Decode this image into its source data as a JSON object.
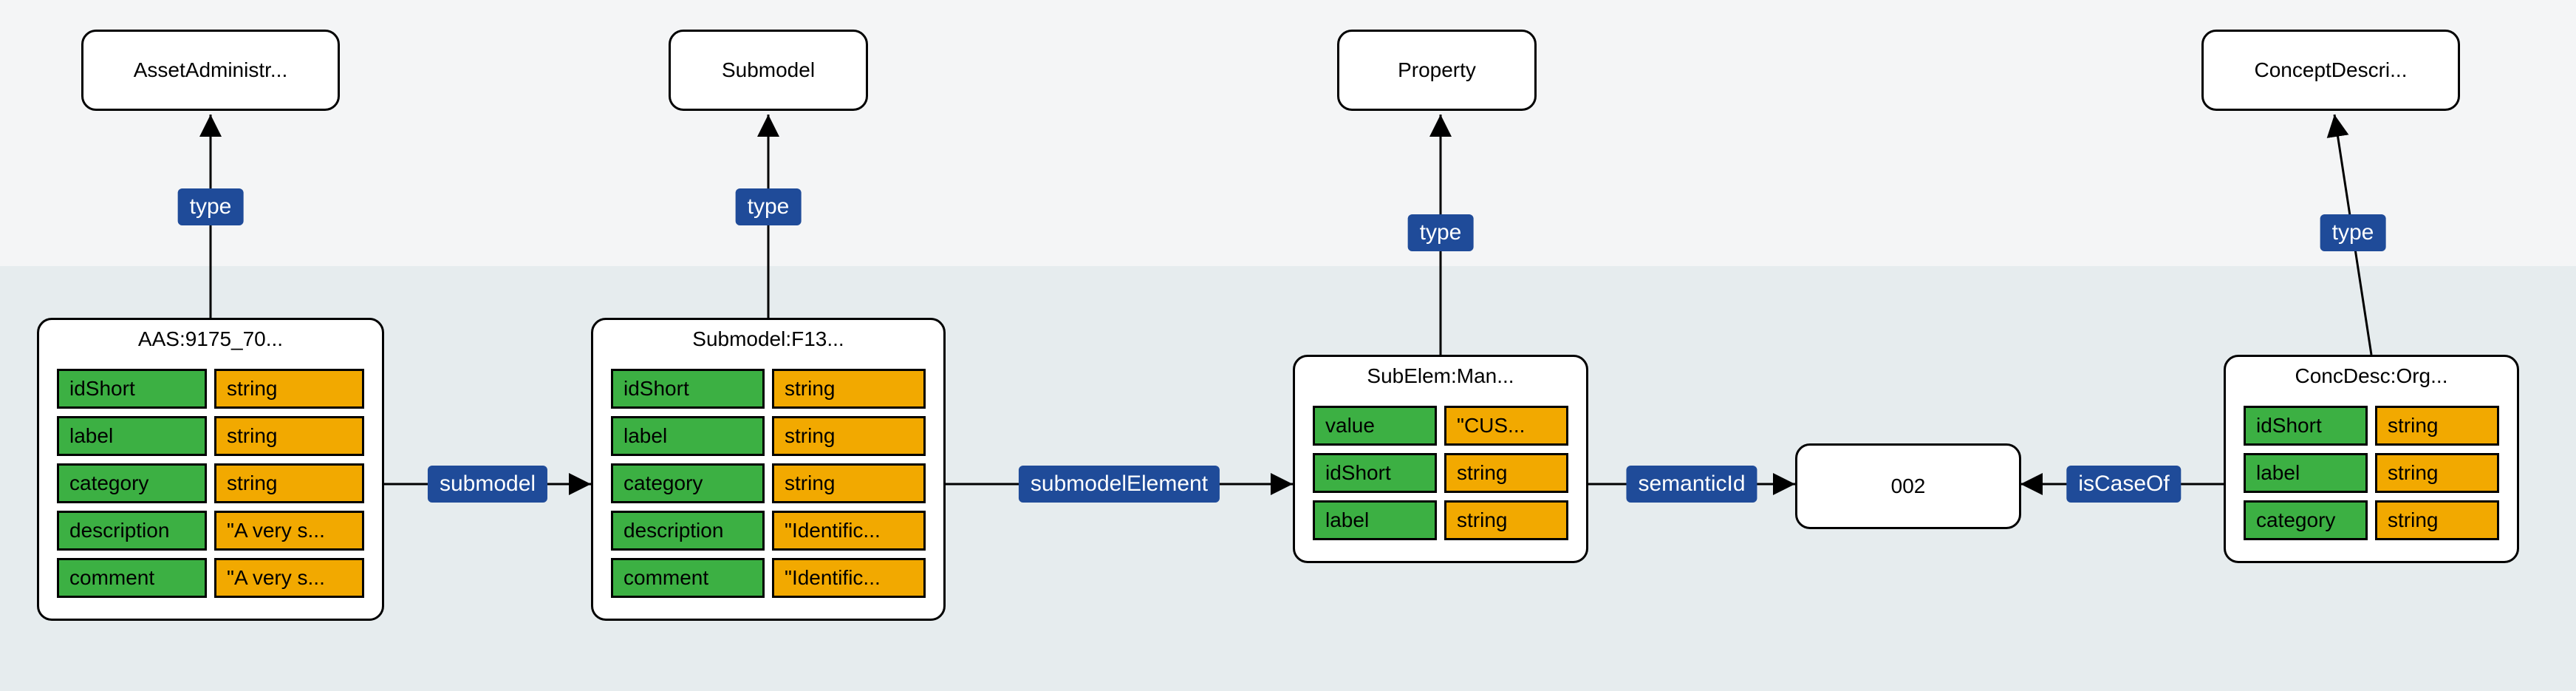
{
  "types": {
    "aas": "AssetAdministr...",
    "sub": "Submodel",
    "prop": "Property",
    "conc": "ConceptDescri..."
  },
  "records": {
    "aas": {
      "title": "AAS:9175_70...",
      "rows": [
        {
          "k": "idShort",
          "v": "string"
        },
        {
          "k": "label",
          "v": "string"
        },
        {
          "k": "category",
          "v": "string"
        },
        {
          "k": "description",
          "v": "\"A very s..."
        },
        {
          "k": "comment",
          "v": "\"A very s..."
        }
      ]
    },
    "sub": {
      "title": "Submodel:F13...",
      "rows": [
        {
          "k": "idShort",
          "v": "string"
        },
        {
          "k": "label",
          "v": "string"
        },
        {
          "k": "category",
          "v": "string"
        },
        {
          "k": "description",
          "v": "\"Identific..."
        },
        {
          "k": "comment",
          "v": "\"Identific..."
        }
      ]
    },
    "prop": {
      "title": "SubElem:Man...",
      "rows": [
        {
          "k": "value",
          "v": "\"CUS..."
        },
        {
          "k": "idShort",
          "v": "string"
        },
        {
          "k": "label",
          "v": "string"
        }
      ]
    },
    "conc": {
      "title": "ConcDesc:Org...",
      "rows": [
        {
          "k": "idShort",
          "v": "string"
        },
        {
          "k": "label",
          "v": "string"
        },
        {
          "k": "category",
          "v": "string"
        }
      ]
    }
  },
  "plain": {
    "n002": "002"
  },
  "edges": {
    "type": "type",
    "submodel": "submodel",
    "submodelElement": "submodelElement",
    "semanticId": "semanticId",
    "isCaseOf": "isCaseOf"
  }
}
